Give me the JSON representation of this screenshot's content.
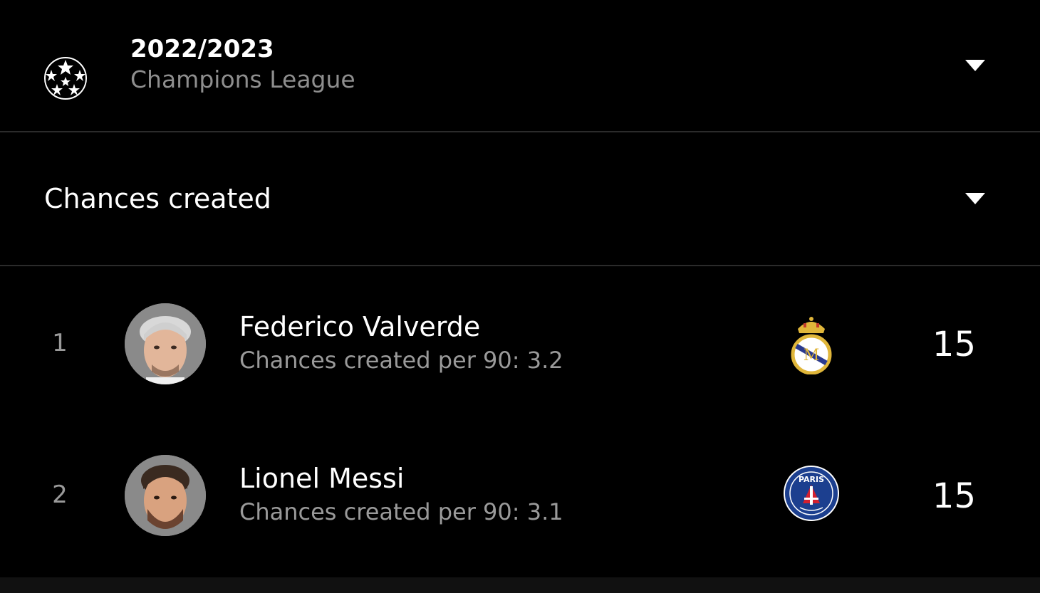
{
  "season": {
    "year": "2022/2023",
    "league": "Champions League",
    "logo_icon": "champions-league-starball-icon",
    "dropdown_icon": "caret-down-icon"
  },
  "stat": {
    "label": "Chances created",
    "dropdown_icon": "caret-down-icon"
  },
  "players": [
    {
      "rank": "1",
      "name": "Federico Valverde",
      "subtitle": "Chances created per 90: 3.2",
      "club_icon": "real-madrid-crest-icon",
      "value": "15"
    },
    {
      "rank": "2",
      "name": "Lionel Messi",
      "subtitle": "Chances created per 90: 3.1",
      "club_icon": "psg-crest-icon",
      "value": "15"
    }
  ],
  "colors": {
    "background": "#000000",
    "divider": "#2b2b2b",
    "primary_text": "#ffffff",
    "secondary_text": "#8e8e8e",
    "psg_blue": "#1c3f8f",
    "psg_red": "#d22030",
    "madrid_gold": "#e0b63a"
  }
}
